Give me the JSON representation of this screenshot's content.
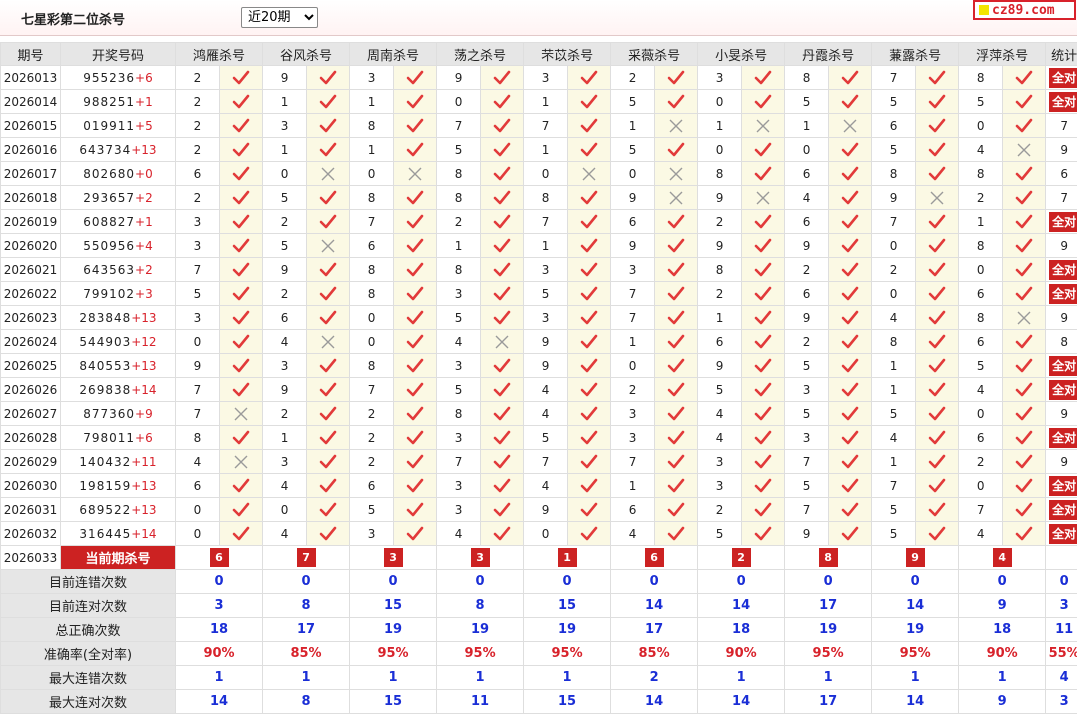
{
  "header": {
    "title": "七星彩第二位杀号",
    "period_select": "近20期",
    "logo": "cz89.com"
  },
  "table": {
    "col_period": "期号",
    "col_draw": "开奖号码",
    "col_stat": "统计",
    "experts": [
      "鸿雁杀号",
      "谷风杀号",
      "周南杀号",
      "荡之杀号",
      "芣苡杀号",
      "采薇杀号",
      "小旻杀号",
      "丹霞杀号",
      "蒹露杀号",
      "浮萍杀号"
    ],
    "rows": [
      {
        "period": "2026013",
        "draw": "955236",
        "sum": "+6",
        "kills": [
          "2",
          "9",
          "3",
          "9",
          "3",
          "2",
          "3",
          "8",
          "7",
          "8"
        ],
        "ok": [
          1,
          1,
          1,
          1,
          1,
          1,
          1,
          1,
          1,
          1
        ],
        "stat": "全对"
      },
      {
        "period": "2026014",
        "draw": "988251",
        "sum": "+1",
        "kills": [
          "2",
          "1",
          "1",
          "0",
          "1",
          "5",
          "0",
          "5",
          "5",
          "5"
        ],
        "ok": [
          1,
          1,
          1,
          1,
          1,
          1,
          1,
          1,
          1,
          1
        ],
        "stat": "全对"
      },
      {
        "period": "2026015",
        "draw": "019911",
        "sum": "+5",
        "kills": [
          "2",
          "3",
          "8",
          "7",
          "7",
          "1",
          "1",
          "1",
          "6",
          "0"
        ],
        "ok": [
          1,
          1,
          1,
          1,
          1,
          0,
          0,
          0,
          1,
          1
        ],
        "stat": "7"
      },
      {
        "period": "2026016",
        "draw": "643734",
        "sum": "+13",
        "kills": [
          "2",
          "1",
          "1",
          "5",
          "1",
          "5",
          "0",
          "0",
          "5",
          "4"
        ],
        "ok": [
          1,
          1,
          1,
          1,
          1,
          1,
          1,
          1,
          1,
          0
        ],
        "stat": "9"
      },
      {
        "period": "2026017",
        "draw": "802680",
        "sum": "+0",
        "kills": [
          "6",
          "0",
          "0",
          "8",
          "0",
          "0",
          "8",
          "6",
          "8",
          "8"
        ],
        "ok": [
          1,
          0,
          0,
          1,
          0,
          0,
          1,
          1,
          1,
          1
        ],
        "stat": "6"
      },
      {
        "period": "2026018",
        "draw": "293657",
        "sum": "+2",
        "kills": [
          "2",
          "5",
          "8",
          "8",
          "8",
          "9",
          "9",
          "4",
          "9",
          "2"
        ],
        "ok": [
          1,
          1,
          1,
          1,
          1,
          0,
          0,
          1,
          0,
          1
        ],
        "stat": "7"
      },
      {
        "period": "2026019",
        "draw": "608827",
        "sum": "+1",
        "kills": [
          "3",
          "2",
          "7",
          "2",
          "7",
          "6",
          "2",
          "6",
          "7",
          "1"
        ],
        "ok": [
          1,
          1,
          1,
          1,
          1,
          1,
          1,
          1,
          1,
          1
        ],
        "stat": "全对"
      },
      {
        "period": "2026020",
        "draw": "550956",
        "sum": "+4",
        "kills": [
          "3",
          "5",
          "6",
          "1",
          "1",
          "9",
          "9",
          "9",
          "0",
          "8"
        ],
        "ok": [
          1,
          0,
          1,
          1,
          1,
          1,
          1,
          1,
          1,
          1
        ],
        "stat": "9"
      },
      {
        "period": "2026021",
        "draw": "643563",
        "sum": "+2",
        "kills": [
          "7",
          "9",
          "8",
          "8",
          "3",
          "3",
          "8",
          "2",
          "2",
          "0"
        ],
        "ok": [
          1,
          1,
          1,
          1,
          1,
          1,
          1,
          1,
          1,
          1
        ],
        "stat": "全对"
      },
      {
        "period": "2026022",
        "draw": "799102",
        "sum": "+3",
        "kills": [
          "5",
          "2",
          "8",
          "3",
          "5",
          "7",
          "2",
          "6",
          "0",
          "6"
        ],
        "ok": [
          1,
          1,
          1,
          1,
          1,
          1,
          1,
          1,
          1,
          1
        ],
        "stat": "全对"
      },
      {
        "period": "2026023",
        "draw": "283848",
        "sum": "+13",
        "kills": [
          "3",
          "6",
          "0",
          "5",
          "3",
          "7",
          "1",
          "9",
          "4",
          "8"
        ],
        "ok": [
          1,
          1,
          1,
          1,
          1,
          1,
          1,
          1,
          1,
          0
        ],
        "stat": "9"
      },
      {
        "period": "2026024",
        "draw": "544903",
        "sum": "+12",
        "kills": [
          "0",
          "4",
          "0",
          "4",
          "9",
          "1",
          "6",
          "2",
          "8",
          "6"
        ],
        "ok": [
          1,
          0,
          1,
          0,
          1,
          1,
          1,
          1,
          1,
          1
        ],
        "stat": "8"
      },
      {
        "period": "2026025",
        "draw": "840553",
        "sum": "+13",
        "kills": [
          "9",
          "3",
          "8",
          "3",
          "9",
          "0",
          "9",
          "5",
          "1",
          "5"
        ],
        "ok": [
          1,
          1,
          1,
          1,
          1,
          1,
          1,
          1,
          1,
          1
        ],
        "stat": "全对"
      },
      {
        "period": "2026026",
        "draw": "269838",
        "sum": "+14",
        "kills": [
          "7",
          "9",
          "7",
          "5",
          "4",
          "2",
          "5",
          "3",
          "1",
          "4"
        ],
        "ok": [
          1,
          1,
          1,
          1,
          1,
          1,
          1,
          1,
          1,
          1
        ],
        "stat": "全对"
      },
      {
        "period": "2026027",
        "draw": "877360",
        "sum": "+9",
        "kills": [
          "7",
          "2",
          "2",
          "8",
          "4",
          "3",
          "4",
          "5",
          "5",
          "0"
        ],
        "ok": [
          0,
          1,
          1,
          1,
          1,
          1,
          1,
          1,
          1,
          1
        ],
        "stat": "9"
      },
      {
        "period": "2026028",
        "draw": "798011",
        "sum": "+6",
        "kills": [
          "8",
          "1",
          "2",
          "3",
          "5",
          "3",
          "4",
          "3",
          "4",
          "6"
        ],
        "ok": [
          1,
          1,
          1,
          1,
          1,
          1,
          1,
          1,
          1,
          1
        ],
        "stat": "全对"
      },
      {
        "period": "2026029",
        "draw": "140432",
        "sum": "+11",
        "kills": [
          "4",
          "3",
          "2",
          "7",
          "7",
          "7",
          "3",
          "7",
          "1",
          "2"
        ],
        "ok": [
          0,
          1,
          1,
          1,
          1,
          1,
          1,
          1,
          1,
          1
        ],
        "stat": "9"
      },
      {
        "period": "2026030",
        "draw": "198159",
        "sum": "+13",
        "kills": [
          "6",
          "4",
          "6",
          "3",
          "4",
          "1",
          "3",
          "5",
          "7",
          "0"
        ],
        "ok": [
          1,
          1,
          1,
          1,
          1,
          1,
          1,
          1,
          1,
          1
        ],
        "stat": "全对"
      },
      {
        "period": "2026031",
        "draw": "689522",
        "sum": "+13",
        "kills": [
          "0",
          "0",
          "5",
          "3",
          "9",
          "6",
          "2",
          "7",
          "5",
          "7"
        ],
        "ok": [
          1,
          1,
          1,
          1,
          1,
          1,
          1,
          1,
          1,
          1
        ],
        "stat": "全对"
      },
      {
        "period": "2026032",
        "draw": "316445",
        "sum": "+14",
        "kills": [
          "0",
          "4",
          "3",
          "4",
          "0",
          "4",
          "5",
          "9",
          "5",
          "4"
        ],
        "ok": [
          1,
          1,
          1,
          1,
          1,
          1,
          1,
          1,
          1,
          1
        ],
        "stat": "全对"
      }
    ],
    "current": {
      "period": "2026033",
      "label": "当前期杀号",
      "kills": [
        "6",
        "7",
        "3",
        "3",
        "1",
        "6",
        "2",
        "8",
        "9",
        "4"
      ]
    },
    "summary": [
      {
        "label": "目前连错次数",
        "values": [
          "0",
          "0",
          "0",
          "0",
          "0",
          "0",
          "0",
          "0",
          "0",
          "0"
        ],
        "stat": "0",
        "red": false
      },
      {
        "label": "目前连对次数",
        "values": [
          "3",
          "8",
          "15",
          "8",
          "15",
          "14",
          "14",
          "17",
          "14",
          "9"
        ],
        "stat": "3",
        "red": false
      },
      {
        "label": "总正确次数",
        "values": [
          "18",
          "17",
          "19",
          "19",
          "19",
          "17",
          "18",
          "19",
          "19",
          "18"
        ],
        "stat": "11",
        "red": false
      },
      {
        "label": "准确率(全对率)",
        "values": [
          "90%",
          "85%",
          "95%",
          "95%",
          "95%",
          "85%",
          "90%",
          "95%",
          "95%",
          "90%"
        ],
        "stat": "55%",
        "red": true
      },
      {
        "label": "最大连错次数",
        "values": [
          "1",
          "1",
          "1",
          "1",
          "1",
          "2",
          "1",
          "1",
          "1",
          "1"
        ],
        "stat": "4",
        "red": false
      },
      {
        "label": "最大连对次数",
        "values": [
          "14",
          "8",
          "15",
          "11",
          "15",
          "14",
          "14",
          "17",
          "14",
          "9"
        ],
        "stat": "3",
        "red": false
      }
    ]
  },
  "colors": {
    "accent_red": "#d8222b",
    "check": "#e23a3a",
    "cross": "#9a9a9a",
    "blue_value": "#1a2ed6"
  }
}
